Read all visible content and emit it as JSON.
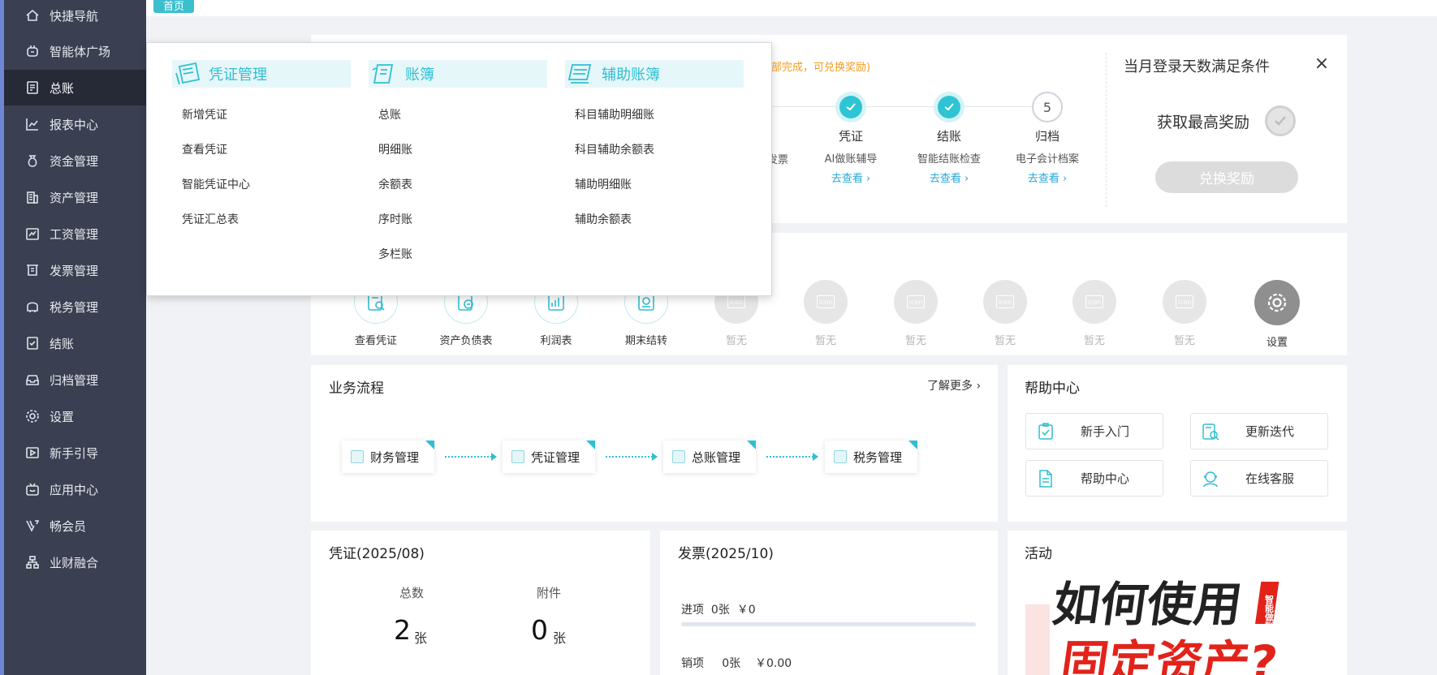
{
  "sidebar": {
    "items": [
      {
        "label": "快捷导航",
        "icon": "home-icon"
      },
      {
        "label": "智能体广场",
        "icon": "robot-icon"
      },
      {
        "label": "总账",
        "icon": "ledger-icon",
        "active": true
      },
      {
        "label": "报表中心",
        "icon": "chart-icon"
      },
      {
        "label": "资金管理",
        "icon": "money-bag-icon"
      },
      {
        "label": "资产管理",
        "icon": "building-icon"
      },
      {
        "label": "工资管理",
        "icon": "payroll-icon"
      },
      {
        "label": "发票管理",
        "icon": "invoice-icon"
      },
      {
        "label": "税务管理",
        "icon": "tax-icon"
      },
      {
        "label": "结账",
        "icon": "checkout-icon"
      },
      {
        "label": "归档管理",
        "icon": "archive-icon"
      },
      {
        "label": "设置",
        "icon": "gear-icon"
      },
      {
        "label": "新手引导",
        "icon": "play-icon"
      },
      {
        "label": "应用中心",
        "icon": "app-icon"
      },
      {
        "label": "畅会员",
        "icon": "vip-icon"
      },
      {
        "label": "业财融合",
        "icon": "org-icon"
      }
    ]
  },
  "topbar": {
    "home_tab": "首页"
  },
  "reward": {
    "hint": "部完成，可兑换奖励)",
    "partial_step": "发票",
    "steps": [
      {
        "title": "凭证",
        "desc": "AI做账辅导",
        "link": "去查看",
        "status": "done"
      },
      {
        "title": "结账",
        "desc": "智能结账检查",
        "link": "去查看",
        "status": "done"
      },
      {
        "title": "归档",
        "desc": "电子会计档案",
        "link": "去查看",
        "status": "pending",
        "number": "5"
      }
    ],
    "side_title": "当月登录天数满足条件",
    "close": "×",
    "get_reward": "获取最高奖励",
    "redeem": "兑换奖励"
  },
  "quick": {
    "items": [
      {
        "label": "查看凭证",
        "state": "on"
      },
      {
        "label": "资产负债表",
        "state": "on"
      },
      {
        "label": "利润表",
        "state": "on"
      },
      {
        "label": "期末结转",
        "state": "on"
      },
      {
        "label": "暂无",
        "state": "off"
      },
      {
        "label": "暂无",
        "state": "off"
      },
      {
        "label": "暂无",
        "state": "off"
      },
      {
        "label": "暂无",
        "state": "off"
      },
      {
        "label": "暂无",
        "state": "off"
      },
      {
        "label": "暂无",
        "state": "off"
      },
      {
        "label": "设置",
        "state": "gear"
      }
    ],
    "icon_tag": "icon"
  },
  "flow": {
    "title": "业务流程",
    "more": "了解更多",
    "steps": [
      "财务管理",
      "凭证管理",
      "总账管理",
      "税务管理"
    ]
  },
  "help": {
    "title": "帮助中心",
    "buttons": [
      "新手入门",
      "更新迭代",
      "帮助中心",
      "在线客服"
    ]
  },
  "voucher": {
    "title": "凭证(2025/08)",
    "total_label": "总数",
    "total_value": "2",
    "attach_label": "附件",
    "attach_value": "0",
    "unit": "张"
  },
  "invoice": {
    "title": "发票(2025/10)",
    "in_label": "进项",
    "in_count": "0张",
    "in_amount": "￥0",
    "out_label": "销项",
    "out_count": "0张",
    "out_amount": "￥0.00"
  },
  "activity": {
    "title": "活动",
    "poster_line1": "如何使用",
    "poster_line2": "固定资产?",
    "poster_badge": "智能做账"
  },
  "dropdown": {
    "columns": [
      {
        "head": "凭证管理",
        "items": [
          "新增凭证",
          "查看凭证",
          "智能凭证中心",
          "凭证汇总表"
        ]
      },
      {
        "head": "账簿",
        "items": [
          "总账",
          "明细账",
          "余额表",
          "序时账",
          "多栏账"
        ]
      },
      {
        "head": "辅助账簿",
        "items": [
          "科目辅助明细账",
          "科目辅助余额表",
          "辅助明细账",
          "辅助余额表"
        ]
      }
    ]
  },
  "colors": {
    "accent": "#2ebfd2",
    "sidebar": "#3a3f51",
    "warning": "#f29c1f",
    "link": "#2aa7d6"
  }
}
